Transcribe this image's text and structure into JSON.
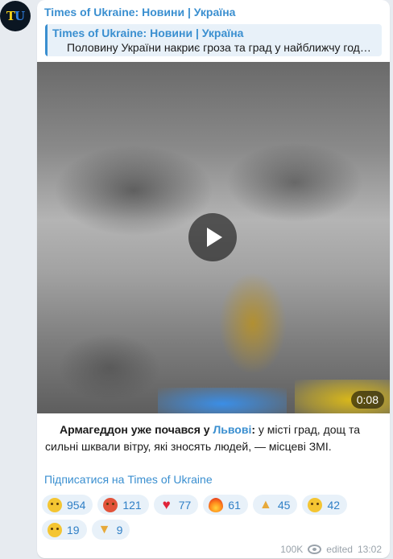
{
  "channel": {
    "avatar_text": "TU",
    "name": "Times of Ukraine: Новини | Україна"
  },
  "reply": {
    "title": "Times of Ukraine: Новини | Україна",
    "text": "Половину України накриє гроза та град у найближчу годину"
  },
  "video": {
    "duration": "0:08"
  },
  "caption": {
    "bold_prefix": "Армагеддон уже почався у ",
    "link": "Львові",
    "bold_colon": ":",
    "rest": " у місті град, дощ та сильні шквали вітру, які зносять людей, — місцеві ЗМІ."
  },
  "subscribe_link": "Підписатися на Times of Ukraine",
  "reactions": [
    {
      "icon": "crying-face-icon",
      "count": "954"
    },
    {
      "icon": "angry-face-icon",
      "count": "121"
    },
    {
      "icon": "heart-icon",
      "count": "77"
    },
    {
      "icon": "fire-icon",
      "count": "61"
    },
    {
      "icon": "thumbs-up-icon",
      "count": "45"
    },
    {
      "icon": "thinking-face-icon",
      "count": "42"
    },
    {
      "icon": "grinning-face-icon",
      "count": "19"
    },
    {
      "icon": "thumbs-down-icon",
      "count": "9"
    }
  ],
  "footer": {
    "views": "100K",
    "edited": "edited",
    "time": "13:02"
  },
  "colors": {
    "accent": "#3a8fd0",
    "background": "#e7ebf0",
    "bubble": "#ffffff"
  }
}
